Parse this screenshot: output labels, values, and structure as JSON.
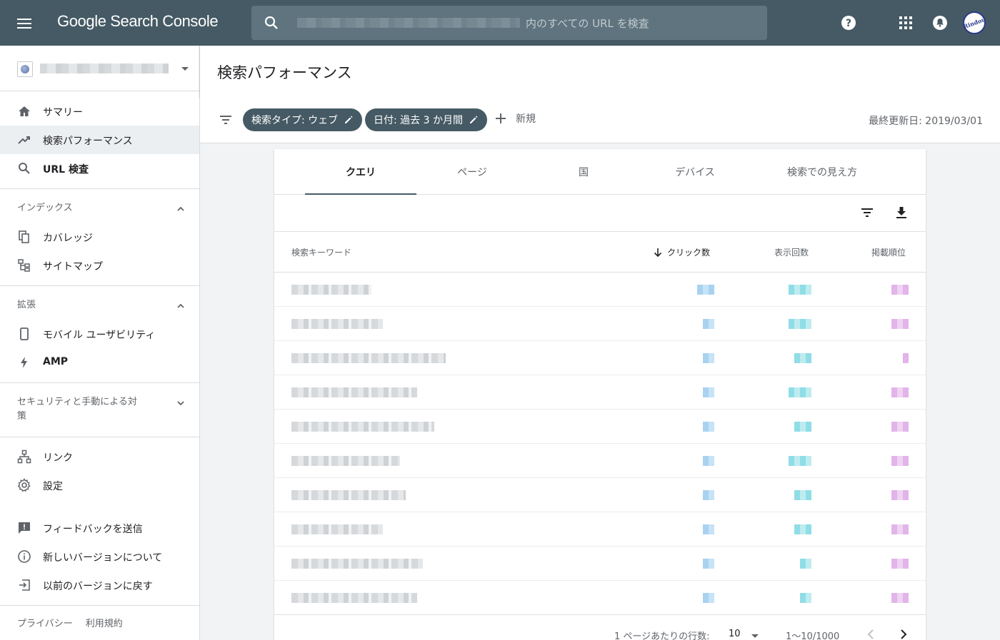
{
  "topbar": {
    "brand": "Google Search Console",
    "search_placeholder": "内のすべての URL を検査"
  },
  "sidebar": {
    "main": [
      {
        "label": "サマリー",
        "icon": "home-icon"
      },
      {
        "label": "検索パフォーマンス",
        "icon": "trending-up-icon",
        "active": true
      },
      {
        "label": "URL 検査",
        "icon": "search-icon",
        "bold": true
      }
    ],
    "index_section": "インデックス",
    "index_items": [
      {
        "label": "カバレッジ",
        "icon": "copy-icon"
      },
      {
        "label": "サイトマップ",
        "icon": "sitemap-icon"
      }
    ],
    "enhance_section": "拡張",
    "enhance_items": [
      {
        "label": "モバイル ユーザビリティ",
        "icon": "phone-icon"
      },
      {
        "label": "AMP",
        "icon": "bolt-icon",
        "bold": true
      }
    ],
    "security_section_line1": "セキュリティと手動による対",
    "security_section_line2": "策",
    "links_items": [
      {
        "label": "リンク",
        "icon": "links-icon"
      },
      {
        "label": "設定",
        "icon": "gear-icon"
      }
    ],
    "bottom_items": [
      {
        "label": "フィードバックを送信",
        "icon": "feedback-icon"
      },
      {
        "label": "新しいバージョンについて",
        "icon": "info-icon"
      },
      {
        "label": "以前のバージョンに戻す",
        "icon": "exit-icon"
      }
    ],
    "footer": {
      "privacy": "プライバシー",
      "terms": "利用規約"
    }
  },
  "header": {
    "title": "検索パフォーマンス"
  },
  "filters": {
    "chip_search_type": "検索タイプ: ウェブ",
    "chip_date": "日付: 過去 3 か月間",
    "new_label": "新規",
    "last_updated": "最終更新日: 2019/03/01"
  },
  "tabs": [
    "クエリ",
    "ページ",
    "国",
    "デバイス",
    "検索での見え方"
  ],
  "table": {
    "headers": {
      "keyword": "検索キーワード",
      "clicks": "クリック数",
      "impressions": "表示回数",
      "position": "掲載順位"
    }
  },
  "pager": {
    "rows_per_page_label": "1 ページあたりの行数:",
    "rows_per_page": "10",
    "range": "1〜10/1000"
  },
  "colors": {
    "topbar": "#455a64",
    "chip": "#455a64",
    "active_nav": "#eceff1"
  }
}
